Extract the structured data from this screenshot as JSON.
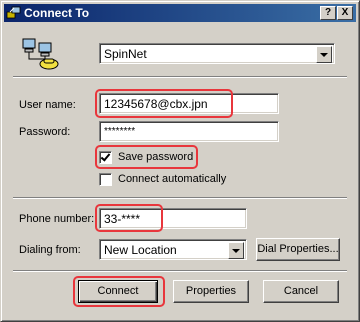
{
  "window": {
    "title": "Connect To",
    "help_button": "?",
    "close_button": "X"
  },
  "connection": {
    "name": "SpinNet"
  },
  "labels": {
    "user_name": "User name:",
    "password": "Password:",
    "save_password": "Save password",
    "connect_automatically": "Connect automatically",
    "phone_number": "Phone number:",
    "dialing_from": "Dialing from:"
  },
  "fields": {
    "user_name": "12345678@cbx.jpn",
    "password": "********",
    "phone_number": "33-****",
    "dialing_from": "New Location"
  },
  "checkboxes": {
    "save_password": true,
    "connect_automatically": false
  },
  "buttons": {
    "dial_properties": "Dial Properties...",
    "connect": "Connect",
    "properties": "Properties",
    "cancel": "Cancel"
  },
  "colors": {
    "title_bar": "#0a246a",
    "highlight": "#e8363c",
    "face": "#d4d0c8"
  }
}
